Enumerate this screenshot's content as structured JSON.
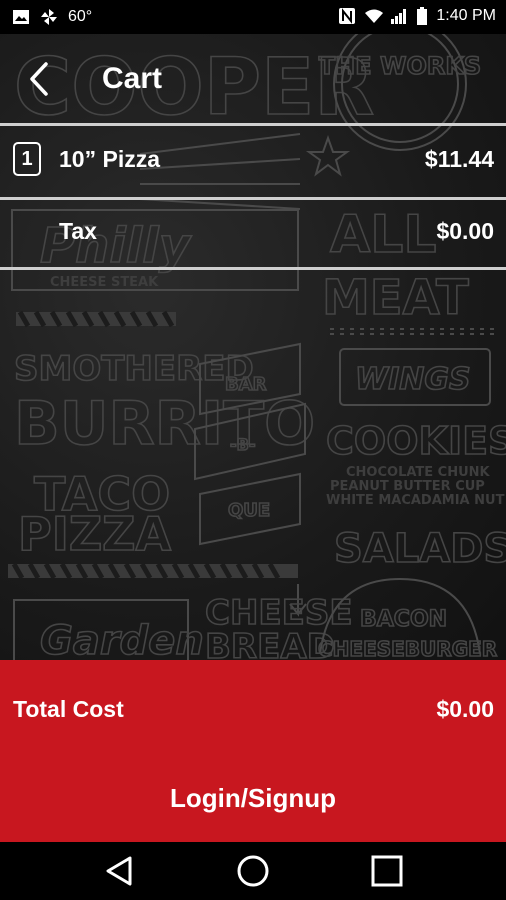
{
  "status_bar": {
    "temperature": "60°",
    "time": "1:40 PM",
    "icons": [
      "image-icon",
      "pinwheel-icon",
      "nfc-icon",
      "wifi-icon",
      "signal-icon",
      "battery-icon"
    ]
  },
  "header": {
    "title": "Cart",
    "back_icon": "chevron-left-icon"
  },
  "cart": {
    "items": [
      {
        "quantity": "1",
        "name": "10” Pizza",
        "price": "$11.44"
      }
    ],
    "tax": {
      "label": "Tax",
      "value": "$0.00"
    }
  },
  "total": {
    "label": "Total Cost",
    "value": "$0.00",
    "action_label": "Login/Signup",
    "color": "#c8171f"
  },
  "background_art": {
    "words": [
      "COOPER",
      "THE WORKS",
      "Philly",
      "CHEESE STEAK",
      "ALL",
      "MEAT",
      "SMOTHERED",
      "BURRITO",
      "BAR",
      "-B-",
      "QUE",
      "WINGS",
      "COOKIES",
      "CHOCOLATE CHUNK",
      "PEANUT BUTTER CUP",
      "WHITE MACADAMIA NUT",
      "TACO",
      "PIZZA",
      "SALADS",
      "CHEESE",
      "BREAD",
      "Garden",
      "BACON",
      "CHEESEBURGER"
    ]
  },
  "nav_bar": {
    "icons": [
      "back-triangle-icon",
      "home-circle-icon",
      "recents-square-icon"
    ]
  }
}
